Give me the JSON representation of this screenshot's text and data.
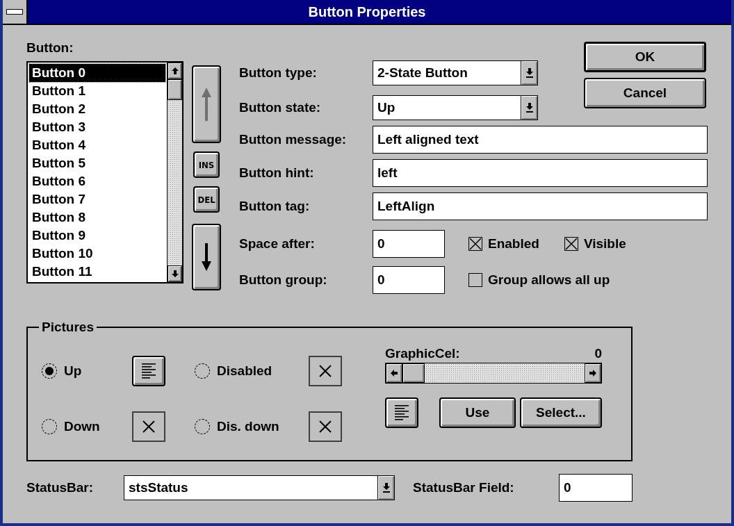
{
  "window": {
    "title": "Button Properties"
  },
  "button_list": {
    "label": "Button:",
    "items": [
      {
        "label": "Button 0",
        "selected": true
      },
      {
        "label": "Button 1",
        "selected": false
      },
      {
        "label": "Button 2",
        "selected": false
      },
      {
        "label": "Button 3",
        "selected": false
      },
      {
        "label": "Button 4",
        "selected": false
      },
      {
        "label": "Button 5",
        "selected": false
      },
      {
        "label": "Button 6",
        "selected": false
      },
      {
        "label": "Button 7",
        "selected": false
      },
      {
        "label": "Button 8",
        "selected": false
      },
      {
        "label": "Button 9",
        "selected": false
      },
      {
        "label": "Button 10",
        "selected": false
      },
      {
        "label": "Button 11",
        "selected": false
      }
    ]
  },
  "list_tools": [
    "INS",
    "DEL"
  ],
  "ok_button": "OK",
  "cancel_button": "Cancel",
  "fields": [
    {
      "kind": "dropdown",
      "label": "Button type:",
      "value": "2-State Button"
    },
    {
      "kind": "dropdown",
      "label": "Button state:",
      "value": "Up"
    },
    {
      "kind": "text",
      "label": "Button message:",
      "value": "Left aligned text"
    },
    {
      "kind": "text",
      "label": "Button hint:",
      "value": "left"
    },
    {
      "kind": "text",
      "label": "Button tag:",
      "value": "LeftAlign"
    },
    {
      "kind": "short",
      "label": "Space after:",
      "value": "0"
    },
    {
      "kind": "short",
      "label": "Button group:",
      "value": "0"
    }
  ],
  "checkboxes": [
    {
      "label": "Enabled",
      "checked": true
    },
    {
      "label": "Visible",
      "checked": true
    },
    {
      "label": "Group allows all up",
      "checked": false
    }
  ],
  "pictures": {
    "title": "Pictures",
    "states": [
      {
        "label": "Up",
        "selected": true,
        "kind": "lines"
      },
      {
        "label": "Disabled",
        "selected": false,
        "kind": "empty"
      },
      {
        "label": "Down",
        "selected": false,
        "kind": "empty"
      },
      {
        "label": "Dis. down",
        "selected": false,
        "kind": "empty"
      }
    ],
    "graphic_cel": {
      "label": "GraphicCel:",
      "value": "0",
      "level": 0
    },
    "preview": {
      "kind": "lines"
    },
    "use_button": "Use",
    "select_button": "Select..."
  },
  "status_bar": {
    "label": "StatusBar:",
    "value": "stsStatus",
    "field_label": "StatusBar Field:",
    "field_value": "0"
  }
}
